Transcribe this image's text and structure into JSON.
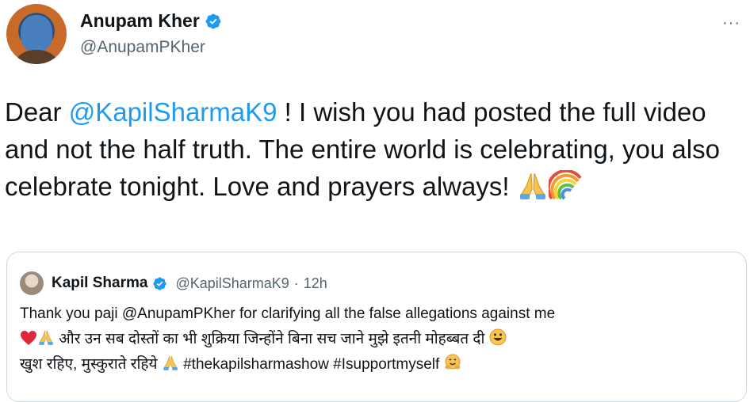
{
  "author": {
    "display_name": "Anupam Kher",
    "handle": "@AnupamPKher",
    "verified_icon": "verified-badge-icon",
    "avatar_icon": "avatar"
  },
  "more_menu": {
    "label": "···"
  },
  "tweet": {
    "text_before": "Dear ",
    "mention": "@KapilSharmaK9",
    "text_after": " ! I wish you had posted the full video and not the half truth. The entire world is celebrating, you also celebrate tonight. Love and prayers always! ",
    "emojis": [
      "folded-hands-icon",
      "rainbow-icon"
    ]
  },
  "quoted": {
    "display_name": "Kapil Sharma",
    "handle": "@KapilSharmaK9",
    "separator": "·",
    "time": "12h",
    "line1": "Thank you paji @AnupamPKher for clarifying all the false allegations against me",
    "line2": " और उन सब दोस्तों का भी शुक्रिया जिन्होंने बिना सच जाने मुझे इतनी मोहब्बत दी ",
    "line3a": "खुश रहिए, मुस्कुराते रहिये ",
    "line3b": " #thekapilsharmashow #Isupportmyself ",
    "emojis": [
      "heart-icon",
      "folded-hands-icon",
      "smile-icon",
      "folded-hands-icon",
      "hug-icon"
    ]
  },
  "colors": {
    "link": "#1d9bf0",
    "secondary_text": "#536471",
    "border": "#cfd9de",
    "verified": "#1d9bf0"
  }
}
